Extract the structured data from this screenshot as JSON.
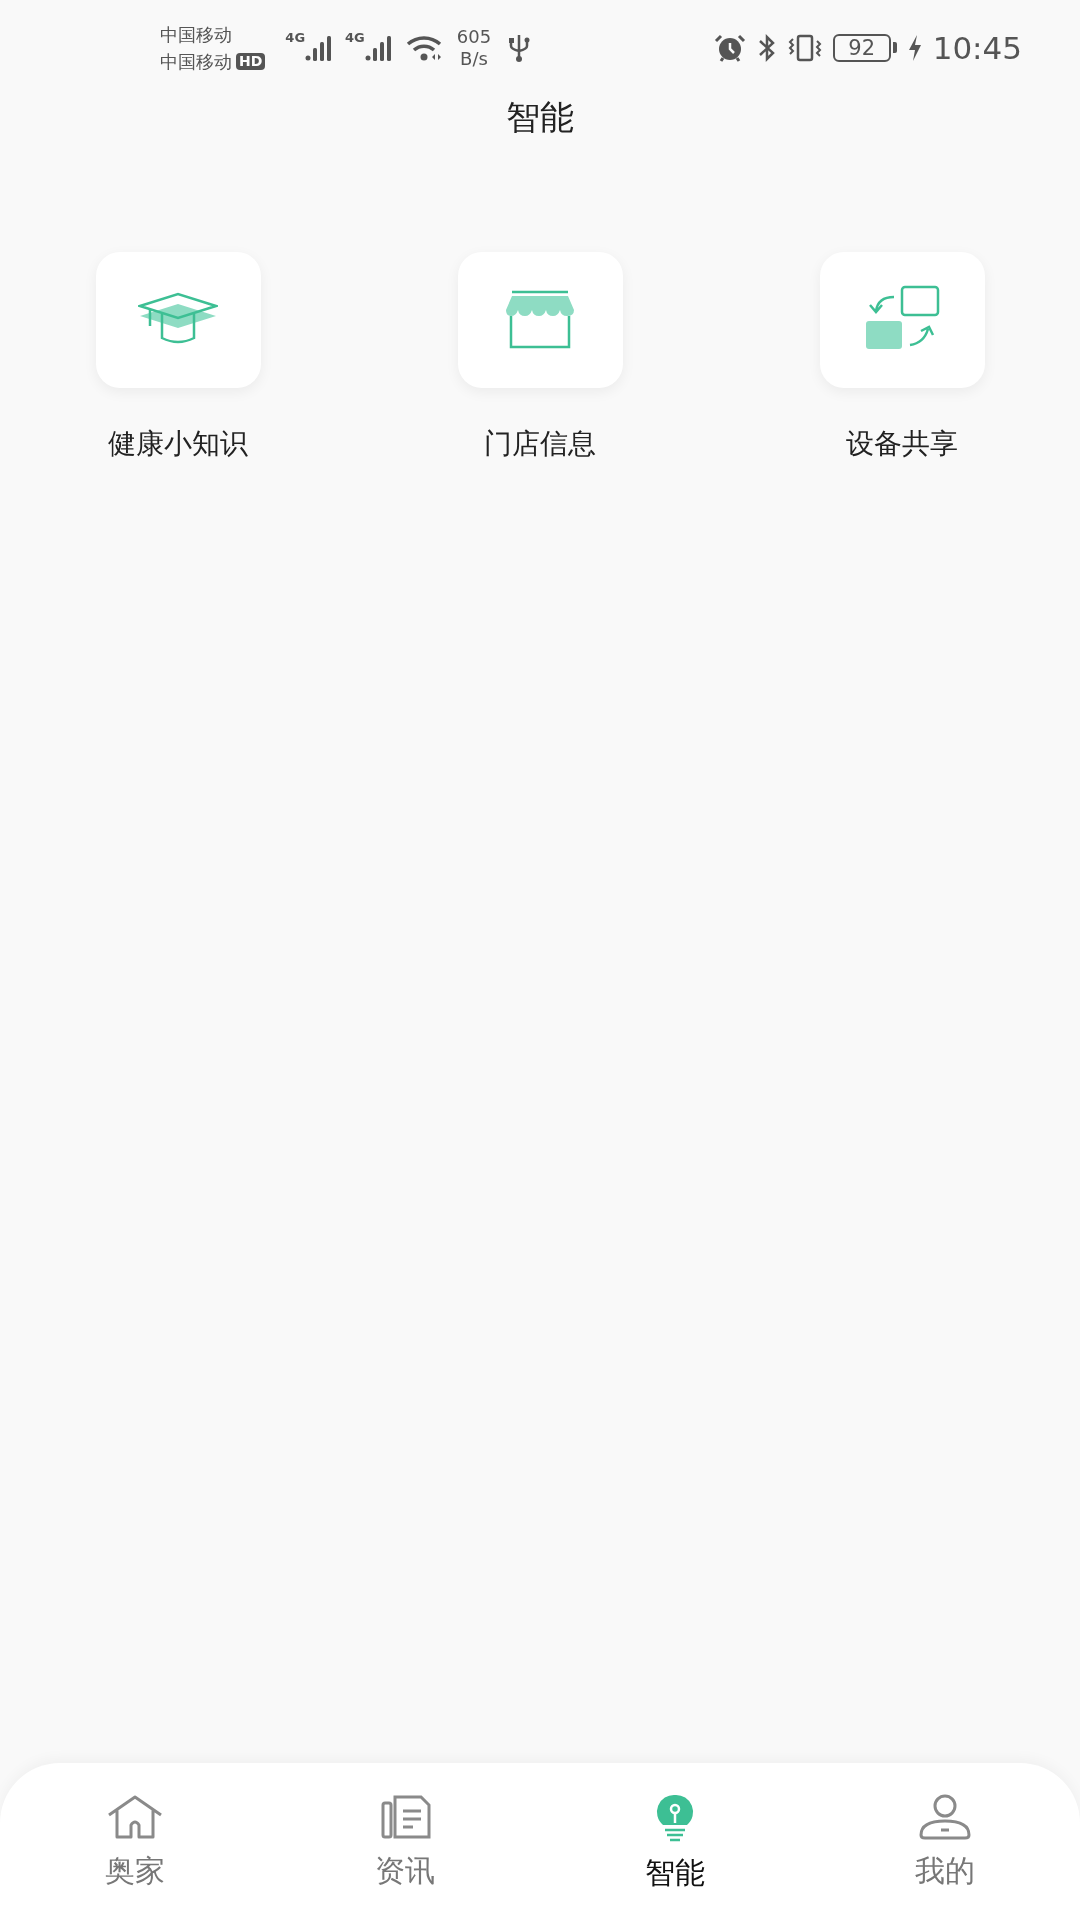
{
  "status_bar": {
    "carriers": [
      "中国移动",
      "中国移动"
    ],
    "hd_badge": "HD",
    "networks": [
      "4G",
      "4G"
    ],
    "speed_value": "605",
    "speed_unit": "B/s",
    "battery": "92",
    "time": "10:45"
  },
  "title": "智能",
  "features": [
    {
      "label": "健康小知识"
    },
    {
      "label": "门店信息"
    },
    {
      "label": "设备共享"
    }
  ],
  "tabs": [
    {
      "label": "奥家",
      "selected": false
    },
    {
      "label": "资讯",
      "selected": false
    },
    {
      "label": "智能",
      "selected": true
    },
    {
      "label": "我的",
      "selected": false
    }
  ]
}
